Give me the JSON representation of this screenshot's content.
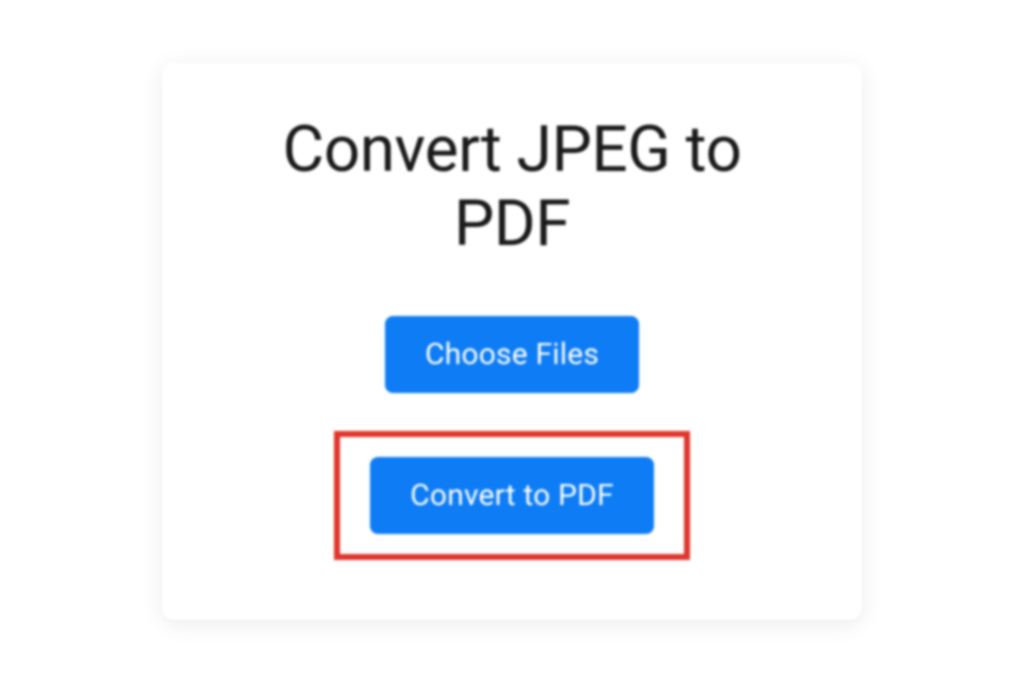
{
  "card": {
    "title": "Convert JPEG to PDF",
    "choose_files_label": "Choose Files",
    "convert_label": "Convert to PDF"
  },
  "colors": {
    "accent": "#0d7cf5",
    "highlight": "#e0352b"
  }
}
